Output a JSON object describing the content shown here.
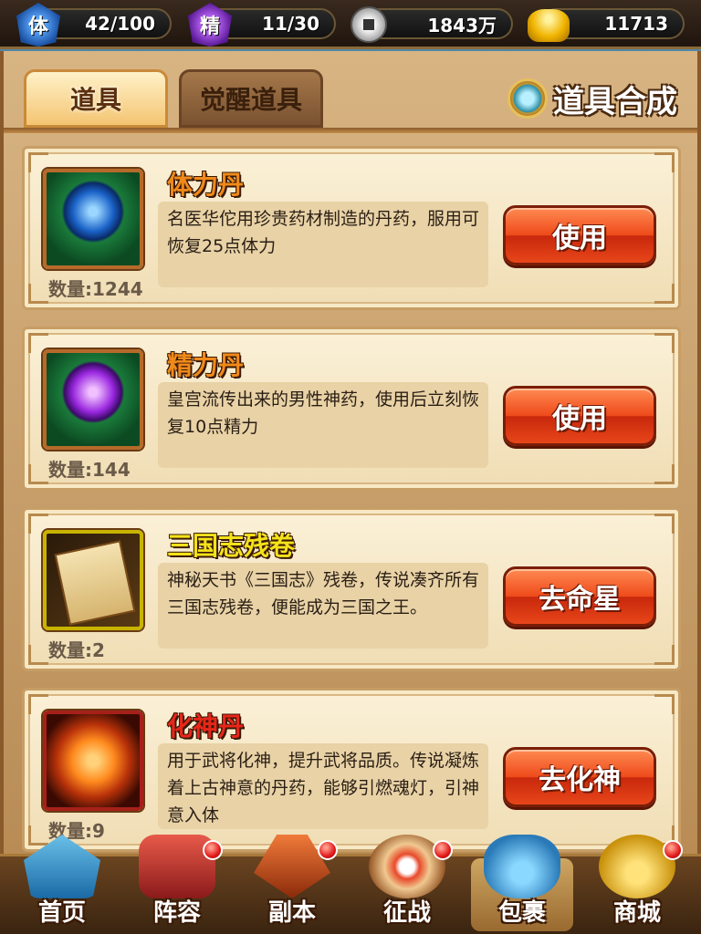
{
  "resources": {
    "stamina": {
      "icon": "stamina-icon",
      "icon_glyph": "体",
      "value": "42/100"
    },
    "energy": {
      "icon": "energy-icon",
      "icon_glyph": "精",
      "value": "11/30"
    },
    "coins": {
      "icon": "coin-icon",
      "value": "1843万"
    },
    "gold": {
      "icon": "gold-ingot-icon",
      "value": "11713"
    }
  },
  "tabs": [
    {
      "label": "道具",
      "active": true
    },
    {
      "label": "觉醒道具",
      "active": false
    }
  ],
  "synthesis": {
    "label": "道具合成",
    "icon": "magic-mirror-icon"
  },
  "items": [
    {
      "name": "体力丹",
      "title_color": "#f08a1a",
      "icon": "stamina-pill-icon",
      "description": "名医华佗用珍贵药材制造的丹药，服用可恢复25点体力",
      "quantity_label": "数量:1244",
      "action": "使用"
    },
    {
      "name": "精力丹",
      "title_color": "#f08a1a",
      "icon": "energy-pill-icon",
      "description": "皇宫流传出来的男性神药，使用后立刻恢复10点精力",
      "quantity_label": "数量:144",
      "action": "使用"
    },
    {
      "name": "三国志残卷",
      "title_color": "#f4e21a",
      "icon": "scroll-icon",
      "description": "神秘天书《三国志》残卷，传说凑齐所有三国志残卷，便能成为三国之王。",
      "quantity_label": "数量:2",
      "action": "去命星"
    },
    {
      "name": "化神丹",
      "title_color": "#e8261a",
      "icon": "deify-pill-icon",
      "description": "用于武将化神，提升武将品质。传说凝炼着上古神意的丹药，能够引燃魂灯，引神意入体",
      "quantity_label": "数量:9",
      "action": "去化神"
    }
  ],
  "bottom_nav": [
    {
      "label": "首页",
      "icon": "palace-icon",
      "badge": false,
      "active": false
    },
    {
      "label": "阵容",
      "icon": "banner-icon",
      "badge": true,
      "active": false
    },
    {
      "label": "副本",
      "icon": "axe-icon",
      "badge": true,
      "active": false
    },
    {
      "label": "征战",
      "icon": "target-icon",
      "badge": true,
      "active": false
    },
    {
      "label": "包裹",
      "icon": "bag-icon",
      "badge": false,
      "active": true
    },
    {
      "label": "商城",
      "icon": "shop-icon",
      "badge": true,
      "active": false
    }
  ]
}
